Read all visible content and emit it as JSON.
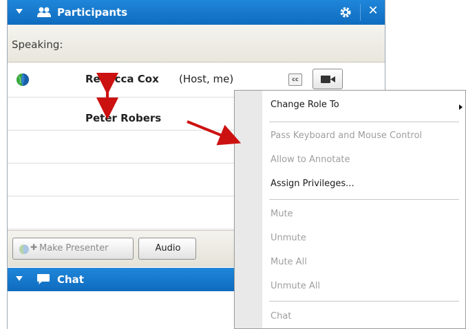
{
  "participants_panel": {
    "title": "Participants",
    "speaking_label": "Speaking:",
    "participants": [
      {
        "name": "Rebecca Cox",
        "role": "(Host, me)",
        "cc_label": "cc"
      },
      {
        "name": "Peter Robers"
      }
    ],
    "buttons": {
      "make_presenter": "Make Presenter",
      "audio": "Audio"
    }
  },
  "chat_panel": {
    "title": "Chat"
  },
  "context_menu": {
    "items": [
      {
        "label": "Change Role To",
        "enabled": true,
        "submenu": true
      },
      {
        "label": "Pass Keyboard and Mouse Control",
        "enabled": false
      },
      {
        "label": "Allow to Annotate",
        "enabled": false
      },
      {
        "label": "Assign Privileges...",
        "enabled": true
      },
      {
        "label": "Mute",
        "enabled": false
      },
      {
        "label": "Unmute",
        "enabled": false
      },
      {
        "label": "Mute All",
        "enabled": false
      },
      {
        "label": "Unmute All",
        "enabled": false
      },
      {
        "label": "Chat",
        "enabled": false
      }
    ]
  },
  "colors": {
    "header_blue": "#1378cf",
    "annotation_arrow": "#cc1111",
    "disabled_text": "#9e9e9e"
  },
  "icons": [
    "triangle-down-icon",
    "people-icon",
    "gear-icon",
    "close-icon",
    "globe-icon",
    "cc-icon",
    "camera-icon",
    "presenter-icon",
    "chat-bubble-icon",
    "submenu-arrow-icon"
  ]
}
